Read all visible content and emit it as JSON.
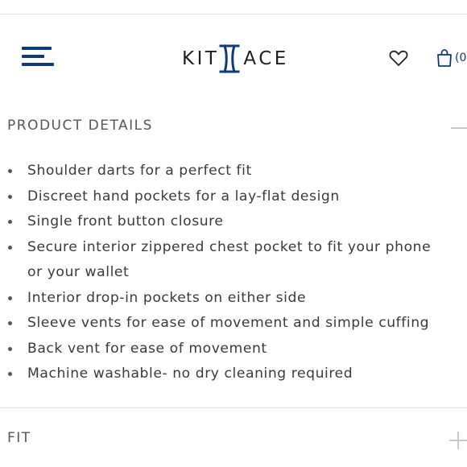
{
  "header": {
    "logo_left": "KIT",
    "logo_right": "ACE",
    "menu_icon": "hamburger-menu-icon",
    "wishlist_icon": "heart-icon",
    "cart_icon": "shopping-bag-icon",
    "cart_count": "(0",
    "brand_color": "#0f3a78"
  },
  "product_details": {
    "title": "PRODUCT DETAILS",
    "toggle_icon": "minus-icon",
    "items": [
      "Shoulder darts for a perfect fit",
      "Discreet hand pockets for a lay-flat design",
      "Single front button closure",
      "Secure interior zippered chest pocket to fit your phone",
      "Interior drop-in pockets on either side",
      "Sleeve vents for ease of movement and simple cuffing",
      "Back vent for ease of movement",
      "Machine washable- no dry cleaning required"
    ],
    "item_3_continuation": "or your wallet"
  },
  "fit": {
    "title": "FIT",
    "toggle_icon": "plus-icon"
  }
}
